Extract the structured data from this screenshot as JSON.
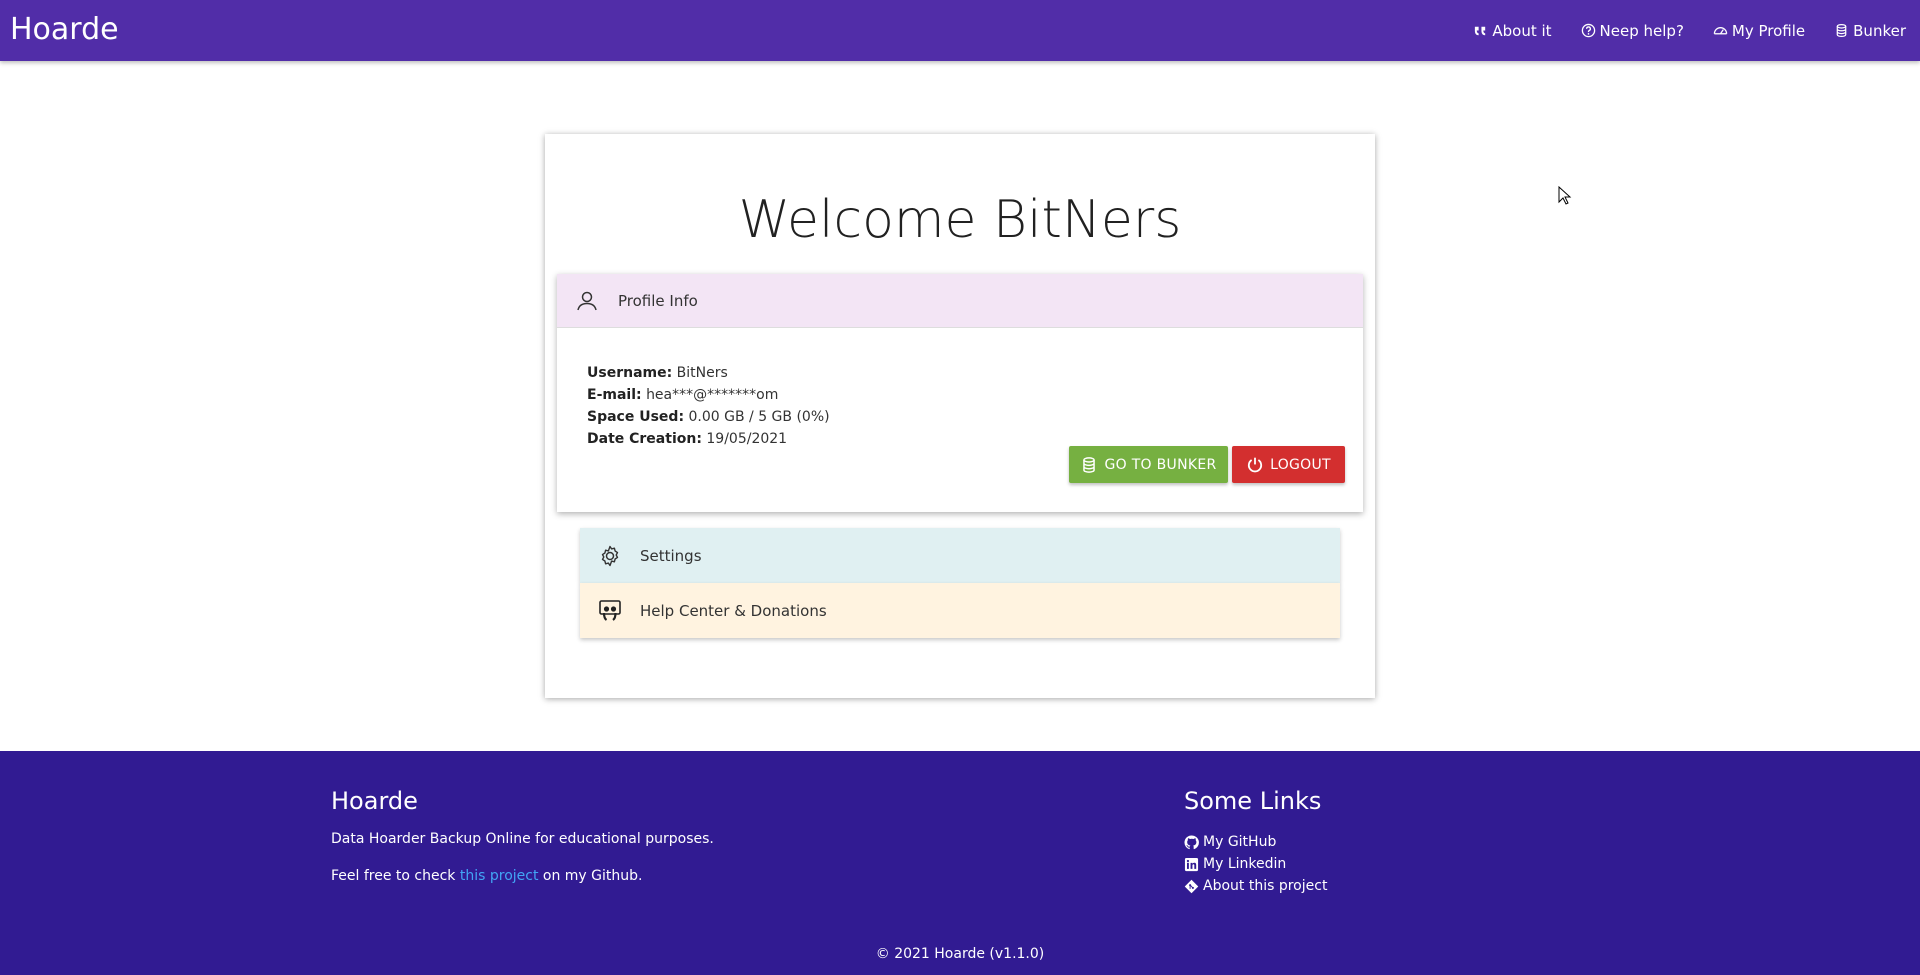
{
  "header": {
    "brand": "Hoarde",
    "nav": [
      {
        "label": "About it",
        "icon": "quote-icon"
      },
      {
        "label": "Neep help?",
        "icon": "question-circle-icon"
      },
      {
        "label": "My Profile",
        "icon": "dashboard-icon"
      },
      {
        "label": "Bunker",
        "icon": "database-icon"
      }
    ]
  },
  "main": {
    "welcome": "Welcome BitNers",
    "profile_panel": {
      "title": "Profile Info",
      "fields": [
        {
          "label": "Username:",
          "value": "BitNers"
        },
        {
          "label": "E-mail:",
          "value": "hea***@*******om"
        },
        {
          "label": "Space Used:",
          "value": "0.00 GB / 5 GB (0%)"
        },
        {
          "label": "Date Creation:",
          "value": "19/05/2021"
        }
      ],
      "bunker_button": "GO TO BUNKER",
      "logout_button": "LOGOUT"
    },
    "settings_panel": {
      "title": "Settings"
    },
    "help_panel": {
      "title": "Help Center & Donations"
    }
  },
  "footer": {
    "title": "Hoarde",
    "description": "Data Hoarder Backup Online for educational purposes.",
    "check_prefix": "Feel free to check ",
    "check_link": "this project",
    "check_suffix": " on my Github.",
    "links_title": "Some Links",
    "links": [
      {
        "label": "My GitHub",
        "icon": "github-icon"
      },
      {
        "label": "My Linkedin",
        "icon": "linkedin-icon"
      },
      {
        "label": "About this project",
        "icon": "git-icon"
      }
    ],
    "copyright": "© 2021 Hoarde (v1.1.0)"
  },
  "colors": {
    "header": "#512da8",
    "footer": "#311b92",
    "bunker_button": "#76b041",
    "logout_button": "#d32f2f",
    "profile_header": "#f3e5f5",
    "settings_header": "#e0f0f2",
    "help_header": "#fff3e0",
    "link": "#42a5f5"
  }
}
